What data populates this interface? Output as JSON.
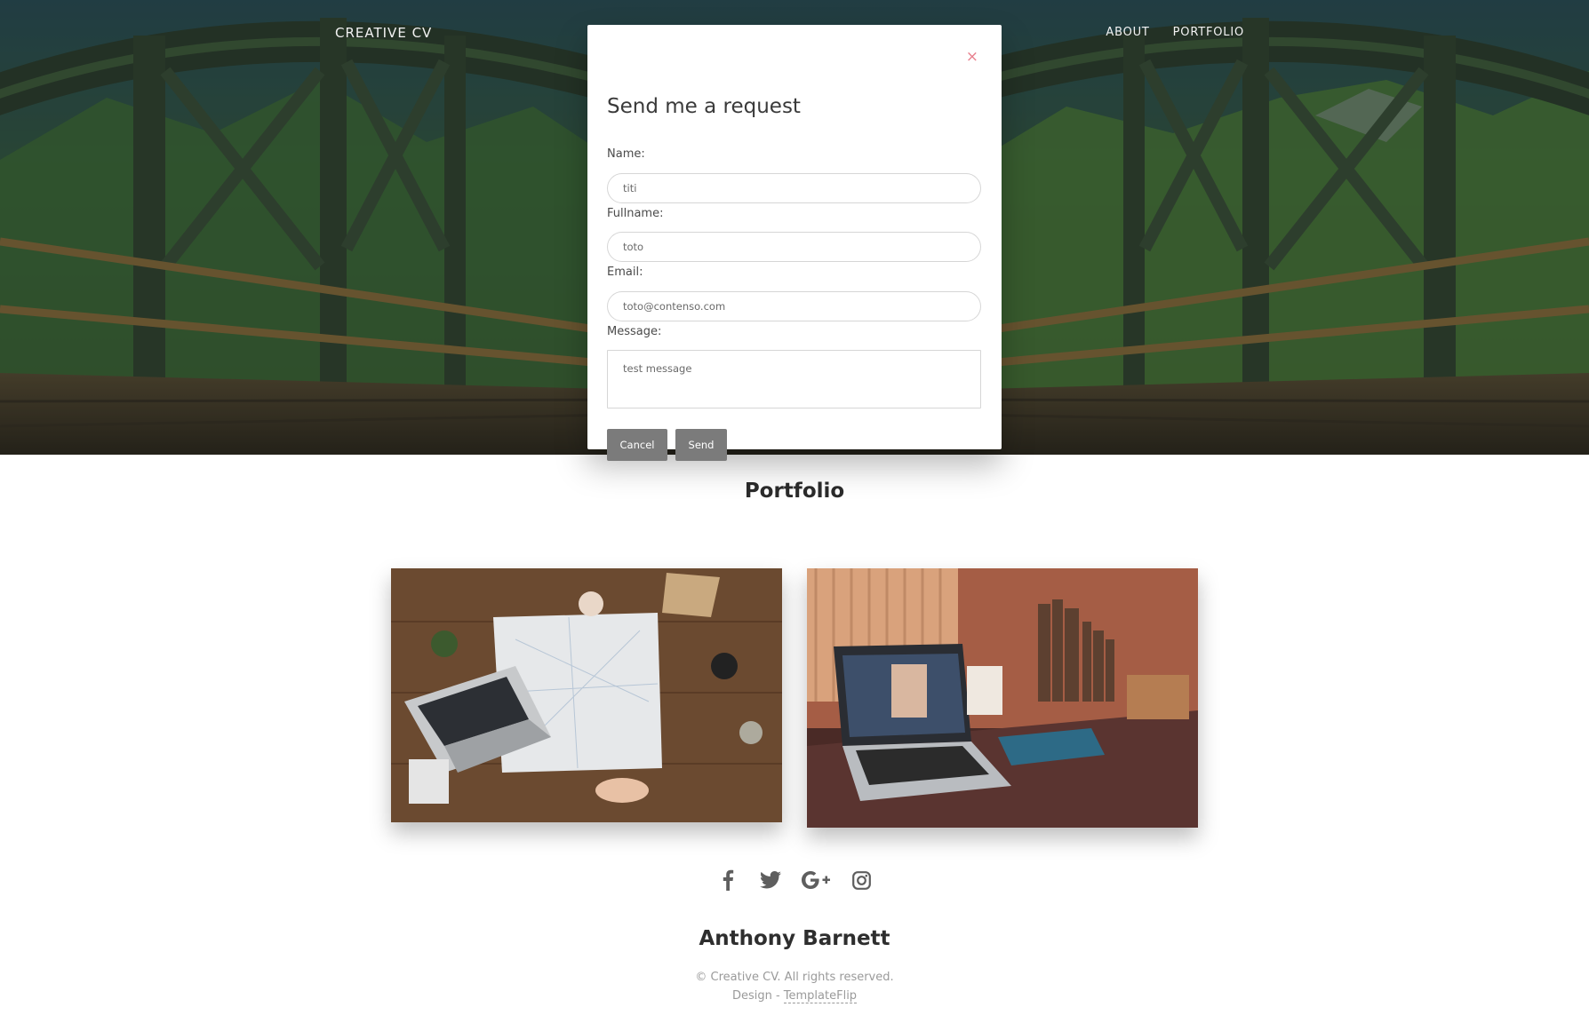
{
  "nav": {
    "brand": "CREATIVE CV",
    "links": [
      "ABOUT",
      "PORTFOLIO"
    ]
  },
  "modal": {
    "title": "Send me a request",
    "close_symbol": "×",
    "fields": {
      "name": {
        "label": "Name:",
        "value": "titi"
      },
      "fullname": {
        "label": "Fullname:",
        "value": "toto"
      },
      "email": {
        "label": "Email:",
        "value": "toto@contenso.com"
      },
      "message": {
        "label": "Message:",
        "value": "test message"
      }
    },
    "buttons": {
      "cancel": "Cancel",
      "send": "Send"
    }
  },
  "portfolio": {
    "title": "Portfolio"
  },
  "footer": {
    "social_icons": [
      "facebook-icon",
      "twitter-icon",
      "google-plus-icon",
      "instagram-icon"
    ],
    "name": "Anthony Barnett",
    "copyright": "© Creative CV. All rights reserved.",
    "design_prefix": "Design - ",
    "design_link": "TemplateFlip"
  },
  "colors": {
    "close_icon": "#e8808e",
    "button_bg": "#7b7b7b",
    "footer_text": "#9a9a9a"
  }
}
